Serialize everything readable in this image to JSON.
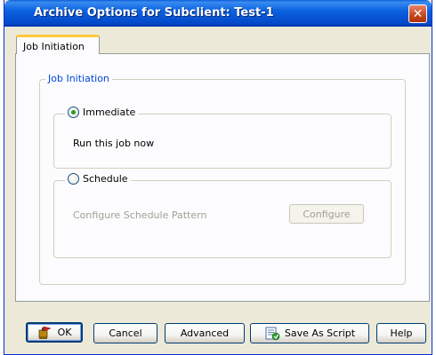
{
  "window": {
    "title": "Archive Options for Subclient: Test-1",
    "close_glyph": "✕"
  },
  "tabs": [
    {
      "label": "Job Initiation",
      "active": true
    }
  ],
  "job_initiation": {
    "group_title": "Job Initiation",
    "immediate": {
      "label": "Immediate",
      "selected": true,
      "description": "Run this job now"
    },
    "schedule": {
      "label": "Schedule",
      "selected": false,
      "pattern_label": "Configure Schedule Pattern",
      "configure_label": "Configure",
      "configure_enabled": false
    }
  },
  "buttons": {
    "ok": "OK",
    "cancel": "Cancel",
    "advanced": "Advanced",
    "save_as_script": "Save As Script",
    "help": "Help"
  },
  "icons": {
    "ok": "ok-flag-icon",
    "save_as_script": "save-script-icon"
  },
  "colors": {
    "titlebar": "#0b62e0",
    "close_button": "#c5461b",
    "group_title": "#0046d5",
    "radio_dot": "#21a121",
    "disabled_text": "#a19f97",
    "tab_highlight": "#ffc83c"
  }
}
